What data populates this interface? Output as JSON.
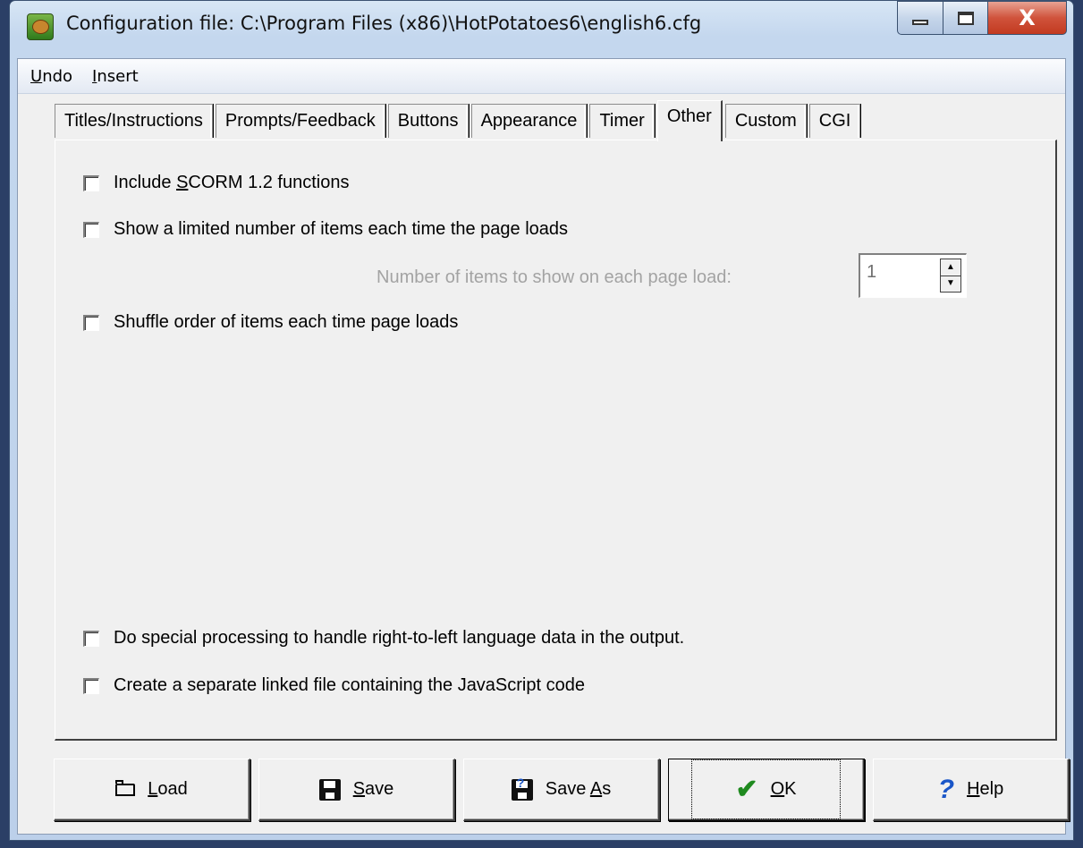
{
  "window": {
    "title": "Configuration file: C:\\Program Files (x86)\\HotPotatoes6\\english6.cfg",
    "close_glyph": "X"
  },
  "menu": {
    "items": [
      {
        "u": "U",
        "rest": "ndo"
      },
      {
        "u": "I",
        "rest": "nsert"
      }
    ]
  },
  "tabs": [
    "Titles/Instructions",
    "Prompts/Feedback",
    "Buttons",
    "Appearance",
    "Timer",
    "Other",
    "Custom",
    "CGI"
  ],
  "active_tab": "Other",
  "options": {
    "scorm": {
      "pre": "Include ",
      "u": "S",
      "post": "CORM 1.2 functions",
      "checked": false
    },
    "limited": {
      "label": "Show a limited number of items each time the page loads",
      "checked": false
    },
    "items_label": "Number of items to show on each page load:",
    "items_value": "1",
    "shuffle": {
      "label": "Shuffle order of items each time page loads",
      "checked": false
    },
    "rtl": {
      "label": "Do special processing to handle right-to-left language data in the output.",
      "checked": false
    },
    "separate_js": {
      "label": "Create a separate linked file containing the JavaScript code",
      "checked": false
    }
  },
  "buttons": {
    "load": {
      "u": "L",
      "rest": "oad",
      "icon": "folder-icon"
    },
    "save": {
      "u": "S",
      "rest": "ave",
      "icon": "disk-icon"
    },
    "save_as": {
      "pre": "Save ",
      "u": "A",
      "rest": "s",
      "icon": "save-as-icon"
    },
    "ok": {
      "u": "O",
      "rest": "K",
      "icon": "check-icon"
    },
    "help": {
      "u": "H",
      "rest": "elp",
      "icon": "help-icon"
    }
  },
  "glyphs": {
    "up": "▲",
    "down": "▼",
    "check": "✔",
    "help": "?",
    "saveas_q": "?"
  }
}
